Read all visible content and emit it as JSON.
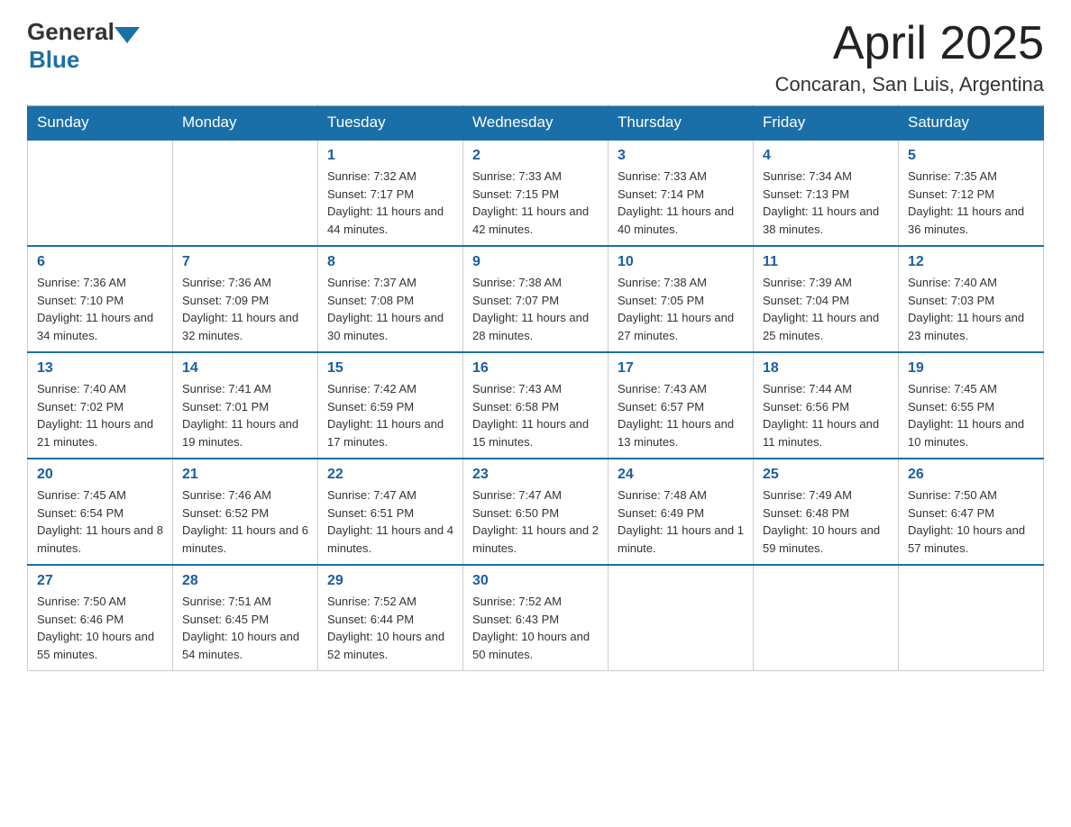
{
  "header": {
    "logo_general": "General",
    "logo_blue": "Blue",
    "month": "April 2025",
    "location": "Concaran, San Luis, Argentina"
  },
  "days_of_week": [
    "Sunday",
    "Monday",
    "Tuesday",
    "Wednesday",
    "Thursday",
    "Friday",
    "Saturday"
  ],
  "weeks": [
    [
      {
        "day": "",
        "sunrise": "",
        "sunset": "",
        "daylight": ""
      },
      {
        "day": "",
        "sunrise": "",
        "sunset": "",
        "daylight": ""
      },
      {
        "day": "1",
        "sunrise": "Sunrise: 7:32 AM",
        "sunset": "Sunset: 7:17 PM",
        "daylight": "Daylight: 11 hours and 44 minutes."
      },
      {
        "day": "2",
        "sunrise": "Sunrise: 7:33 AM",
        "sunset": "Sunset: 7:15 PM",
        "daylight": "Daylight: 11 hours and 42 minutes."
      },
      {
        "day": "3",
        "sunrise": "Sunrise: 7:33 AM",
        "sunset": "Sunset: 7:14 PM",
        "daylight": "Daylight: 11 hours and 40 minutes."
      },
      {
        "day": "4",
        "sunrise": "Sunrise: 7:34 AM",
        "sunset": "Sunset: 7:13 PM",
        "daylight": "Daylight: 11 hours and 38 minutes."
      },
      {
        "day": "5",
        "sunrise": "Sunrise: 7:35 AM",
        "sunset": "Sunset: 7:12 PM",
        "daylight": "Daylight: 11 hours and 36 minutes."
      }
    ],
    [
      {
        "day": "6",
        "sunrise": "Sunrise: 7:36 AM",
        "sunset": "Sunset: 7:10 PM",
        "daylight": "Daylight: 11 hours and 34 minutes."
      },
      {
        "day": "7",
        "sunrise": "Sunrise: 7:36 AM",
        "sunset": "Sunset: 7:09 PM",
        "daylight": "Daylight: 11 hours and 32 minutes."
      },
      {
        "day": "8",
        "sunrise": "Sunrise: 7:37 AM",
        "sunset": "Sunset: 7:08 PM",
        "daylight": "Daylight: 11 hours and 30 minutes."
      },
      {
        "day": "9",
        "sunrise": "Sunrise: 7:38 AM",
        "sunset": "Sunset: 7:07 PM",
        "daylight": "Daylight: 11 hours and 28 minutes."
      },
      {
        "day": "10",
        "sunrise": "Sunrise: 7:38 AM",
        "sunset": "Sunset: 7:05 PM",
        "daylight": "Daylight: 11 hours and 27 minutes."
      },
      {
        "day": "11",
        "sunrise": "Sunrise: 7:39 AM",
        "sunset": "Sunset: 7:04 PM",
        "daylight": "Daylight: 11 hours and 25 minutes."
      },
      {
        "day": "12",
        "sunrise": "Sunrise: 7:40 AM",
        "sunset": "Sunset: 7:03 PM",
        "daylight": "Daylight: 11 hours and 23 minutes."
      }
    ],
    [
      {
        "day": "13",
        "sunrise": "Sunrise: 7:40 AM",
        "sunset": "Sunset: 7:02 PM",
        "daylight": "Daylight: 11 hours and 21 minutes."
      },
      {
        "day": "14",
        "sunrise": "Sunrise: 7:41 AM",
        "sunset": "Sunset: 7:01 PM",
        "daylight": "Daylight: 11 hours and 19 minutes."
      },
      {
        "day": "15",
        "sunrise": "Sunrise: 7:42 AM",
        "sunset": "Sunset: 6:59 PM",
        "daylight": "Daylight: 11 hours and 17 minutes."
      },
      {
        "day": "16",
        "sunrise": "Sunrise: 7:43 AM",
        "sunset": "Sunset: 6:58 PM",
        "daylight": "Daylight: 11 hours and 15 minutes."
      },
      {
        "day": "17",
        "sunrise": "Sunrise: 7:43 AM",
        "sunset": "Sunset: 6:57 PM",
        "daylight": "Daylight: 11 hours and 13 minutes."
      },
      {
        "day": "18",
        "sunrise": "Sunrise: 7:44 AM",
        "sunset": "Sunset: 6:56 PM",
        "daylight": "Daylight: 11 hours and 11 minutes."
      },
      {
        "day": "19",
        "sunrise": "Sunrise: 7:45 AM",
        "sunset": "Sunset: 6:55 PM",
        "daylight": "Daylight: 11 hours and 10 minutes."
      }
    ],
    [
      {
        "day": "20",
        "sunrise": "Sunrise: 7:45 AM",
        "sunset": "Sunset: 6:54 PM",
        "daylight": "Daylight: 11 hours and 8 minutes."
      },
      {
        "day": "21",
        "sunrise": "Sunrise: 7:46 AM",
        "sunset": "Sunset: 6:52 PM",
        "daylight": "Daylight: 11 hours and 6 minutes."
      },
      {
        "day": "22",
        "sunrise": "Sunrise: 7:47 AM",
        "sunset": "Sunset: 6:51 PM",
        "daylight": "Daylight: 11 hours and 4 minutes."
      },
      {
        "day": "23",
        "sunrise": "Sunrise: 7:47 AM",
        "sunset": "Sunset: 6:50 PM",
        "daylight": "Daylight: 11 hours and 2 minutes."
      },
      {
        "day": "24",
        "sunrise": "Sunrise: 7:48 AM",
        "sunset": "Sunset: 6:49 PM",
        "daylight": "Daylight: 11 hours and 1 minute."
      },
      {
        "day": "25",
        "sunrise": "Sunrise: 7:49 AM",
        "sunset": "Sunset: 6:48 PM",
        "daylight": "Daylight: 10 hours and 59 minutes."
      },
      {
        "day": "26",
        "sunrise": "Sunrise: 7:50 AM",
        "sunset": "Sunset: 6:47 PM",
        "daylight": "Daylight: 10 hours and 57 minutes."
      }
    ],
    [
      {
        "day": "27",
        "sunrise": "Sunrise: 7:50 AM",
        "sunset": "Sunset: 6:46 PM",
        "daylight": "Daylight: 10 hours and 55 minutes."
      },
      {
        "day": "28",
        "sunrise": "Sunrise: 7:51 AM",
        "sunset": "Sunset: 6:45 PM",
        "daylight": "Daylight: 10 hours and 54 minutes."
      },
      {
        "day": "29",
        "sunrise": "Sunrise: 7:52 AM",
        "sunset": "Sunset: 6:44 PM",
        "daylight": "Daylight: 10 hours and 52 minutes."
      },
      {
        "day": "30",
        "sunrise": "Sunrise: 7:52 AM",
        "sunset": "Sunset: 6:43 PM",
        "daylight": "Daylight: 10 hours and 50 minutes."
      },
      {
        "day": "",
        "sunrise": "",
        "sunset": "",
        "daylight": ""
      },
      {
        "day": "",
        "sunrise": "",
        "sunset": "",
        "daylight": ""
      },
      {
        "day": "",
        "sunrise": "",
        "sunset": "",
        "daylight": ""
      }
    ]
  ]
}
